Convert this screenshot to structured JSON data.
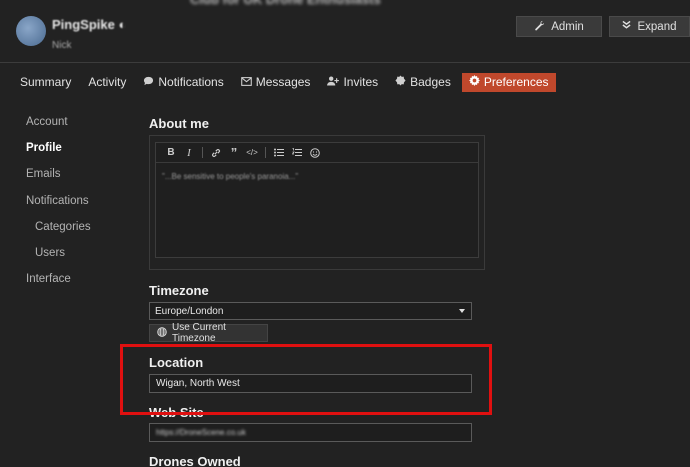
{
  "header": {
    "page_title": "Club for UK Drone Enthusiasts",
    "username": "PingSpike",
    "user_realname": "Nick",
    "admin_label": "Admin",
    "expand_label": "Expand"
  },
  "tabs": [
    {
      "label": "Summary"
    },
    {
      "label": "Activity"
    },
    {
      "label": "Notifications"
    },
    {
      "label": "Messages"
    },
    {
      "label": "Invites"
    },
    {
      "label": "Badges"
    },
    {
      "label": "Preferences"
    }
  ],
  "sidebar": {
    "items": [
      {
        "label": "Account"
      },
      {
        "label": "Profile"
      },
      {
        "label": "Emails"
      },
      {
        "label": "Notifications"
      },
      {
        "label": "Categories"
      },
      {
        "label": "Users"
      },
      {
        "label": "Interface"
      }
    ]
  },
  "about": {
    "label": "About me",
    "text": "\"...Be sensitive to people's paranoia...\""
  },
  "timezone": {
    "label": "Timezone",
    "value": "Europe/London",
    "button": "Use Current Timezone"
  },
  "location": {
    "label": "Location",
    "value": "Wigan, North West"
  },
  "website": {
    "label": "Web Site",
    "value": "https://DroneScene.co.uk"
  },
  "drones": {
    "label": "Drones Owned"
  },
  "colors": {
    "accent": "#c0482c",
    "highlight": "#e01010",
    "background": "#222222"
  }
}
